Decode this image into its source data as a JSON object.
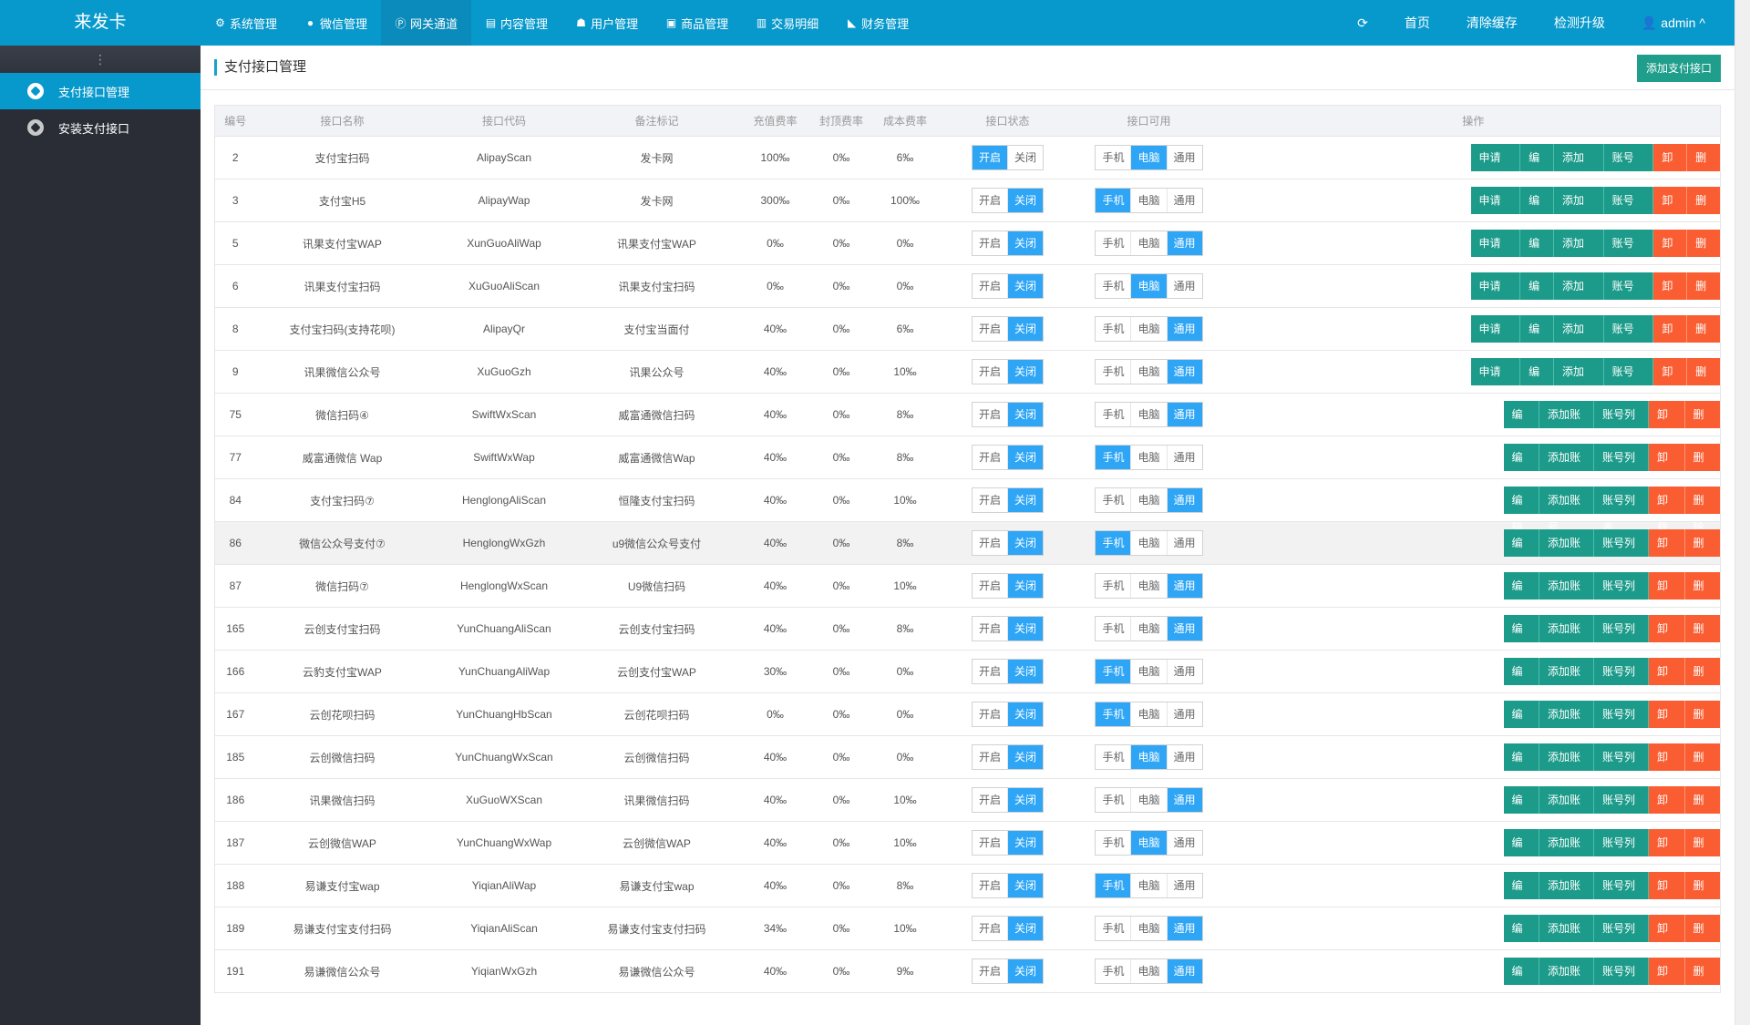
{
  "app": {
    "logo": "来发卡"
  },
  "topnav": [
    {
      "icon": "gear-icon",
      "glyph": "⚙",
      "label": "系统管理",
      "active": false
    },
    {
      "icon": "wechat-icon",
      "glyph": "●",
      "label": "微信管理",
      "active": false
    },
    {
      "icon": "gateway-p-icon",
      "glyph": "Ⓟ",
      "label": "网关通道",
      "active": true
    },
    {
      "icon": "file-icon",
      "glyph": "▤",
      "label": "内容管理",
      "active": false
    },
    {
      "icon": "users-icon",
      "glyph": "☗",
      "label": "用户管理",
      "active": false
    },
    {
      "icon": "shopping-bag-icon",
      "glyph": "▣",
      "label": "商品管理",
      "active": false
    },
    {
      "icon": "bar-chart-icon",
      "glyph": "▥",
      "label": "交易明细",
      "active": false
    },
    {
      "icon": "finance-icon",
      "glyph": "◣",
      "label": "财务管理",
      "active": false
    }
  ],
  "topright": {
    "refresh_glyph": "⟳",
    "home": "首页",
    "clear_cache": "清除缓存",
    "check_update": "检测升级",
    "user_glyph": "👤",
    "user": "admin",
    "caret": "^"
  },
  "sidebar": {
    "toggle_glyph": "⋮",
    "items": [
      {
        "label": "支付接口管理",
        "active": true
      },
      {
        "label": "安装支付接口",
        "active": false
      }
    ]
  },
  "page": {
    "title": "支付接口管理",
    "add_button": "添加支付接口"
  },
  "table": {
    "columns": [
      "编号",
      "接口名称",
      "接口代码",
      "备注标记",
      "充值费率",
      "封顶费率",
      "成本费率",
      "接口状态",
      "接口可用",
      "操作"
    ],
    "status_labels": [
      "开启",
      "关闭"
    ],
    "avail_labels": [
      "手机",
      "电脑",
      "通用"
    ],
    "op_labels": {
      "apply": "申请地址",
      "edit": "编辑",
      "add_account": "添加账号",
      "account_list": "账号列表",
      "uninstall": "卸载",
      "delete": "删除"
    },
    "rows": [
      {
        "id": "2",
        "name": "支付宝扫码",
        "code": "AlipayScan",
        "note": "发卡网",
        "rate": "100‰",
        "cap": "0‰",
        "cost": "6‰",
        "status": "开启",
        "avail": "电脑",
        "apply": true
      },
      {
        "id": "3",
        "name": "支付宝H5",
        "code": "AlipayWap",
        "note": "发卡网",
        "rate": "300‰",
        "cap": "0‰",
        "cost": "100‰",
        "status": "关闭",
        "avail": "手机",
        "apply": true
      },
      {
        "id": "5",
        "name": "讯果支付宝WAP",
        "code": "XunGuoAliWap",
        "note": "讯果支付宝WAP",
        "rate": "0‰",
        "cap": "0‰",
        "cost": "0‰",
        "status": "关闭",
        "avail": "通用",
        "apply": true
      },
      {
        "id": "6",
        "name": "讯果支付宝扫码",
        "code": "XuGuoAliScan",
        "note": "讯果支付宝扫码",
        "rate": "0‰",
        "cap": "0‰",
        "cost": "0‰",
        "status": "关闭",
        "avail": "电脑",
        "apply": true
      },
      {
        "id": "8",
        "name": "支付宝扫码(支持花呗)",
        "code": "AlipayQr",
        "note": "支付宝当面付",
        "rate": "40‰",
        "cap": "0‰",
        "cost": "6‰",
        "status": "关闭",
        "avail": "通用",
        "apply": true
      },
      {
        "id": "9",
        "name": "讯果微信公众号",
        "code": "XuGuoGzh",
        "note": "讯果公众号",
        "rate": "40‰",
        "cap": "0‰",
        "cost": "10‰",
        "status": "关闭",
        "avail": "通用",
        "apply": true
      },
      {
        "id": "75",
        "name": "微信扫码④",
        "code": "SwiftWxScan",
        "note": "威富通微信扫码",
        "rate": "40‰",
        "cap": "0‰",
        "cost": "8‰",
        "status": "关闭",
        "avail": "通用",
        "apply": false
      },
      {
        "id": "77",
        "name": "威富通微信 Wap",
        "code": "SwiftWxWap",
        "note": "威富通微信Wap",
        "rate": "40‰",
        "cap": "0‰",
        "cost": "8‰",
        "status": "关闭",
        "avail": "手机",
        "apply": false
      },
      {
        "id": "84",
        "name": "支付宝扫码⑦",
        "code": "HenglongAliScan",
        "note": "恒隆支付宝扫码",
        "rate": "40‰",
        "cap": "0‰",
        "cost": "10‰",
        "status": "关闭",
        "avail": "通用",
        "apply": false
      },
      {
        "id": "86",
        "name": "微信公众号支付⑦",
        "code": "HenglongWxGzh",
        "note": "u9微信公众号支付",
        "rate": "40‰",
        "cap": "0‰",
        "cost": "8‰",
        "status": "关闭",
        "avail": "手机",
        "apply": false,
        "hover": true
      },
      {
        "id": "87",
        "name": "微信扫码⑦",
        "code": "HenglongWxScan",
        "note": "U9微信扫码",
        "rate": "40‰",
        "cap": "0‰",
        "cost": "10‰",
        "status": "关闭",
        "avail": "通用",
        "apply": false
      },
      {
        "id": "165",
        "name": "云创支付宝扫码",
        "code": "YunChuangAliScan",
        "note": "云创支付宝扫码",
        "rate": "40‰",
        "cap": "0‰",
        "cost": "8‰",
        "status": "关闭",
        "avail": "通用",
        "apply": false
      },
      {
        "id": "166",
        "name": "云豹支付宝WAP",
        "code": "YunChuangAliWap",
        "note": "云创支付宝WAP",
        "rate": "30‰",
        "cap": "0‰",
        "cost": "0‰",
        "status": "关闭",
        "avail": "手机",
        "apply": false
      },
      {
        "id": "167",
        "name": "云创花呗扫码",
        "code": "YunChuangHbScan",
        "note": "云创花呗扫码",
        "rate": "0‰",
        "cap": "0‰",
        "cost": "0‰",
        "status": "关闭",
        "avail": "手机",
        "apply": false
      },
      {
        "id": "185",
        "name": "云创微信扫码",
        "code": "YunChuangWxScan",
        "note": "云创微信扫码",
        "rate": "40‰",
        "cap": "0‰",
        "cost": "0‰",
        "status": "关闭",
        "avail": "电脑",
        "apply": false
      },
      {
        "id": "186",
        "name": "讯果微信扫码",
        "code": "XuGuoWXScan",
        "note": "讯果微信扫码",
        "rate": "40‰",
        "cap": "0‰",
        "cost": "10‰",
        "status": "关闭",
        "avail": "通用",
        "apply": false
      },
      {
        "id": "187",
        "name": "云创微信WAP",
        "code": "YunChuangWxWap",
        "note": "云创微信WAP",
        "rate": "40‰",
        "cap": "0‰",
        "cost": "10‰",
        "status": "关闭",
        "avail": "电脑",
        "apply": false
      },
      {
        "id": "188",
        "name": "易谦支付宝wap",
        "code": "YiqianAliWap",
        "note": "易谦支付宝wap",
        "rate": "40‰",
        "cap": "0‰",
        "cost": "8‰",
        "status": "关闭",
        "avail": "手机",
        "apply": false
      },
      {
        "id": "189",
        "name": "易谦支付宝支付扫码",
        "code": "YiqianAliScan",
        "note": "易谦支付宝支付扫码",
        "rate": "34‰",
        "cap": "0‰",
        "cost": "10‰",
        "status": "关闭",
        "avail": "通用",
        "apply": false
      },
      {
        "id": "191",
        "name": "易谦微信公众号",
        "code": "YiqianWxGzh",
        "note": "易谦微信公众号",
        "rate": "40‰",
        "cap": "0‰",
        "cost": "9‰",
        "status": "关闭",
        "avail": "通用",
        "apply": false
      }
    ]
  },
  "colors": {
    "topbar": "#0899cc",
    "sidebar": "#2a2d36",
    "toggle_on": "#2ea5f5",
    "action_green": "#1c9b8a",
    "action_orange": "#f95d31"
  }
}
